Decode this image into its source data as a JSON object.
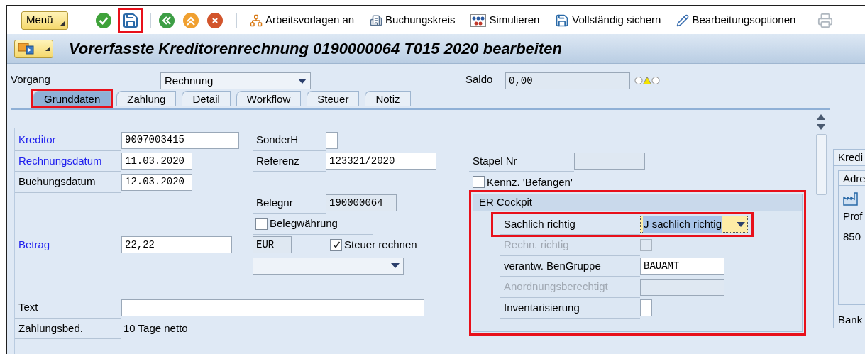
{
  "toolbar": {
    "menu": "Menü",
    "icon_buttons": [
      {
        "highlighted": false
      },
      {
        "highlighted": true
      }
    ],
    "text_buttons": [
      "Arbeitsvorlagen an",
      "Buchungskreis",
      "Simulieren",
      "Vollständig sichern",
      "Bearbeitungsoptionen"
    ]
  },
  "title": "Vorerfasste Kreditorenrechnung 0190000064 T015 2020 bearbeiten",
  "vorgang": {
    "label": "Vorgang",
    "value": "Rechnung"
  },
  "saldo": {
    "label": "Saldo",
    "value": "0,00",
    "warning": true
  },
  "tabs": [
    {
      "label": "Grunddaten",
      "selected": true,
      "highlighted": true
    },
    {
      "label": "Zahlung",
      "selected": false,
      "highlighted": false
    },
    {
      "label": "Detail",
      "selected": false,
      "highlighted": false
    },
    {
      "label": "Workflow",
      "selected": false,
      "highlighted": false
    },
    {
      "label": "Steuer",
      "selected": false,
      "highlighted": false
    },
    {
      "label": "Notiz",
      "selected": false,
      "highlighted": false
    }
  ],
  "left_fields": [
    {
      "label": "Kreditor",
      "value": "9007003415",
      "link": true
    },
    {
      "label": "Rechnungsdatum",
      "value": "11.03.2020",
      "link": true
    },
    {
      "label": "Buchungsdatum",
      "value": "12.03.2020",
      "link": false
    },
    {
      "label": "Betrag",
      "value": "22,22",
      "link": true
    }
  ],
  "sonderh": {
    "label": "SonderH"
  },
  "referenz": {
    "label": "Referenz",
    "value": "123321/2020"
  },
  "belegnr": {
    "label": "Belegnr",
    "value": "190000064"
  },
  "belegwaehrung": {
    "label": "Belegwährung",
    "checked": false
  },
  "currency": "EUR",
  "steuer_rechnen": {
    "label": "Steuer rechnen",
    "checked": true
  },
  "text_field": {
    "label": "Text"
  },
  "zahlungsbed": {
    "label": "Zahlungsbed.",
    "value": "10 Tage netto"
  },
  "stapel": {
    "label": "Stapel Nr"
  },
  "befangen": {
    "label": "Kennz. 'Befangen'",
    "checked": false
  },
  "er_cockpit": {
    "title": "ER Cockpit",
    "highlighted": true,
    "rows": [
      {
        "kind": "dropdown",
        "label": "Sachlich richtig",
        "value": "J sachlich richtig",
        "highlighted": true,
        "disabled": false
      },
      {
        "kind": "checkbox",
        "label": "Rechn. richtig",
        "checked": false,
        "highlighted": false,
        "disabled": true
      },
      {
        "kind": "text",
        "label": "verantw. BenGruppe",
        "value": "BAUAMT",
        "highlighted": false,
        "disabled": false
      },
      {
        "kind": "text",
        "label": "Anordnungsberechtigt",
        "highlighted": false,
        "disabled": true
      },
      {
        "kind": "short",
        "label": "Inventarisierung",
        "highlighted": false,
        "disabled": false
      }
    ]
  },
  "side_panel": {
    "tab": "Kredi",
    "subtab": "Adre",
    "lines": [
      "Prof",
      "850"
    ],
    "bank": "Bank"
  }
}
